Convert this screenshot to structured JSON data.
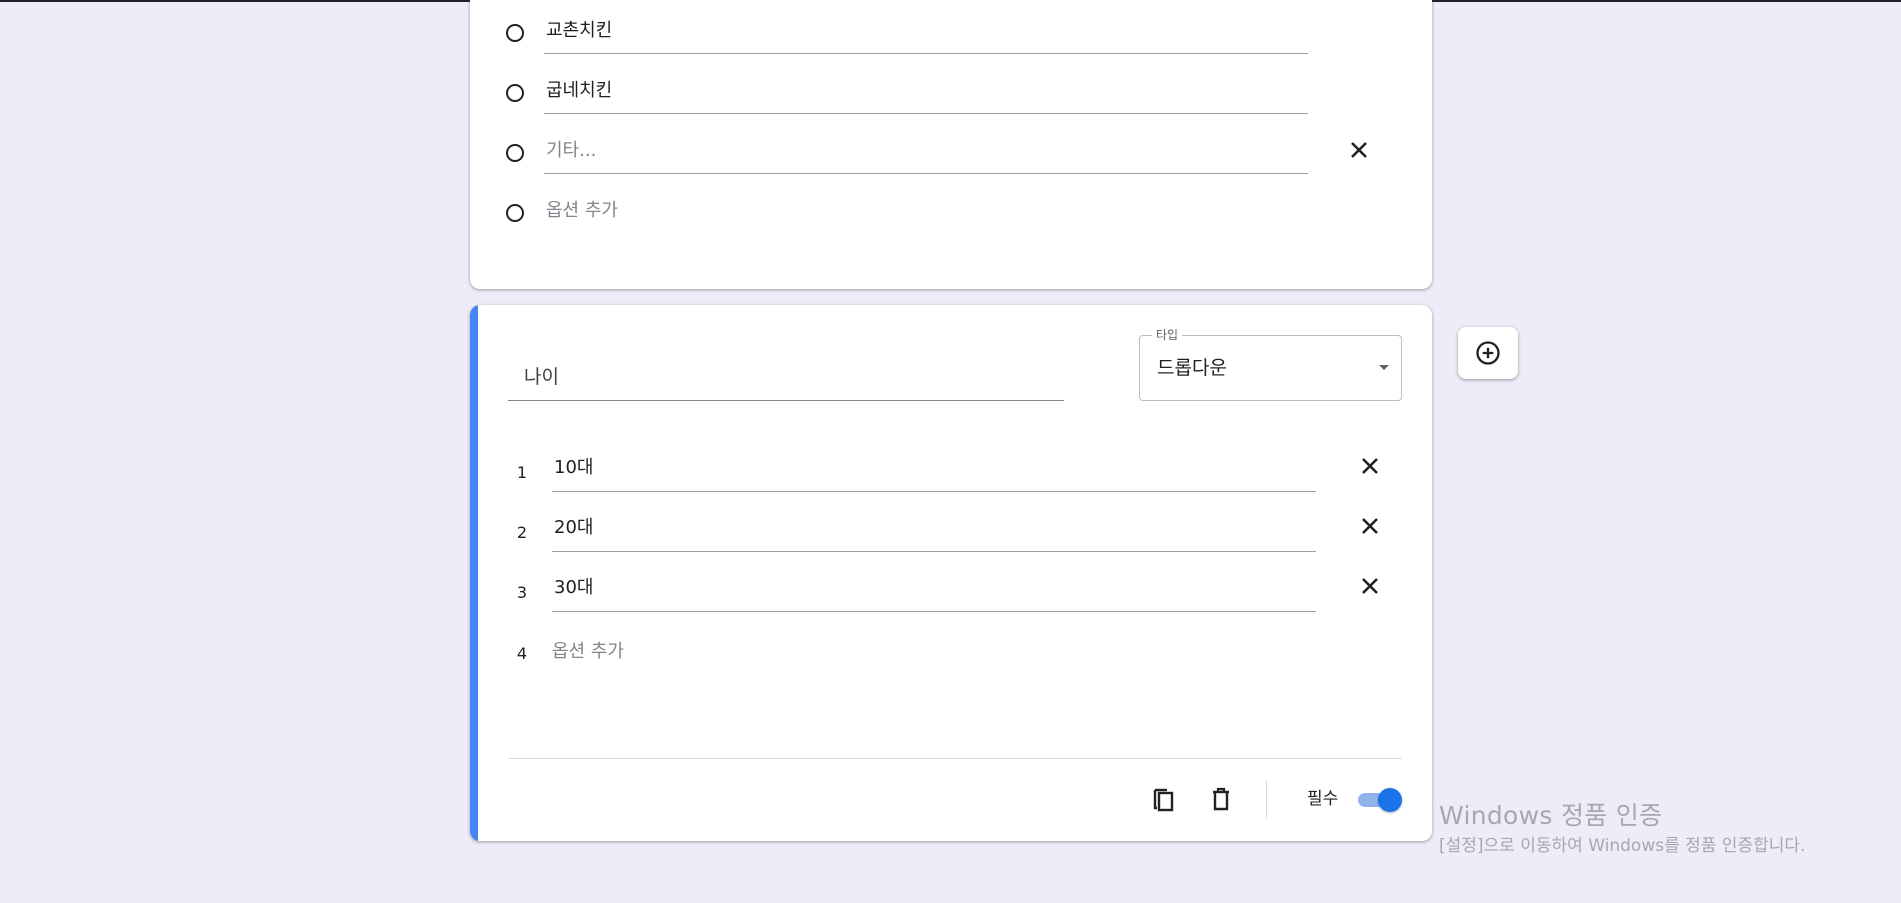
{
  "multiple_choice_card": {
    "options": [
      {
        "label": "교촌치킨",
        "removable": false
      },
      {
        "label": "굽네치킨",
        "removable": false
      }
    ],
    "other_placeholder": "기타...",
    "add_option_label": "옵션 추가"
  },
  "dropdown_card": {
    "question_title": "나이",
    "type_select": {
      "label": "타입",
      "selected_value": "드롭다운"
    },
    "options": [
      {
        "number": "1",
        "label": "10대"
      },
      {
        "number": "2",
        "label": "20대"
      },
      {
        "number": "3",
        "label": "30대"
      }
    ],
    "add_option": {
      "number": "4",
      "label": "옵션 추가"
    },
    "footer": {
      "copy_icon": "copy-icon",
      "delete_icon": "trash-icon",
      "required_label": "필수",
      "required_on": true
    },
    "accent_color": "#4285f4"
  },
  "side_toolbar": {
    "add_question_icon": "add-circle-icon"
  },
  "watermark": {
    "title": "Windows 정품 인증",
    "subtitle": "[설정]으로 이동하여 Windows를 정품 인증합니다."
  },
  "colors": {
    "background": "#efebf8",
    "toggle_on": "#1a73e8"
  }
}
